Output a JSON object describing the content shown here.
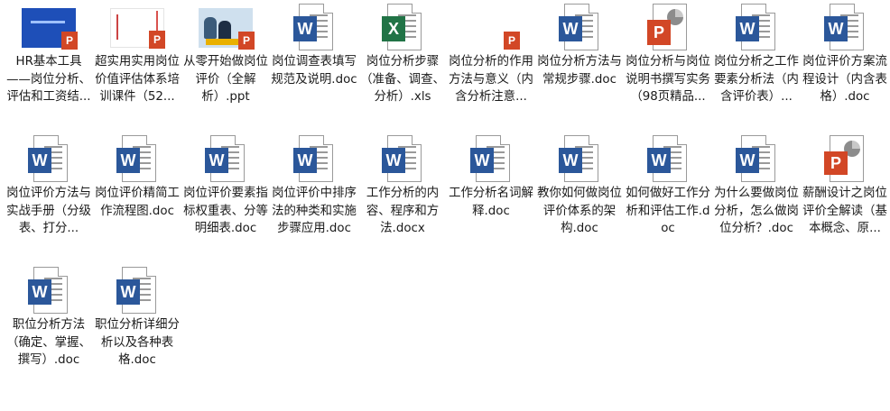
{
  "files": [
    {
      "name": "HR基本工具——岗位分析、评估和工资结...",
      "icon": "ppt-thumbnail-blue"
    },
    {
      "name": "超实用实用岗位价值评估体系培训课件（52...",
      "icon": "ppt-thumbnail-white"
    },
    {
      "name": "从零开始做岗位评价（全解析）.ppt",
      "icon": "ppt-thumbnail-photo"
    },
    {
      "name": "岗位调查表填写规范及说明.doc",
      "icon": "word-doc-icon"
    },
    {
      "name": "岗位分析步骤（准备、调查、分析）.xls",
      "icon": "excel-xls-icon"
    },
    {
      "name": "岗位分析的作用方法与意义（内含分析注意...",
      "icon": "ppt-thumbnail-plain"
    },
    {
      "name": "岗位分析方法与常规步骤.doc",
      "icon": "word-doc-icon"
    },
    {
      "name": "岗位分析与岗位说明书撰写实务（98页精品...",
      "icon": "powerpoint-icon"
    },
    {
      "name": "岗位分析之工作要素分析法（内含评价表）...",
      "icon": "word-doc-icon"
    },
    {
      "name": "岗位评价方案流程设计（内含表格）.doc",
      "icon": "word-doc-icon"
    },
    {
      "name": "岗位评价方法与实战手册（分级表、打分...",
      "icon": "word-doc-icon"
    },
    {
      "name": "岗位评价精简工作流程图.doc",
      "icon": "word-doc-icon"
    },
    {
      "name": "岗位评价要素指标权重表、分等明细表.doc",
      "icon": "word-doc-icon"
    },
    {
      "name": "岗位评价中排序法的种类和实施步骤应用.doc",
      "icon": "word-doc-icon"
    },
    {
      "name": "工作分析的内容、程序和方法.docx",
      "icon": "word-docx-icon"
    },
    {
      "name": "工作分析名词解释.doc",
      "icon": "word-doc-icon"
    },
    {
      "name": "教你如何做岗位评价体系的架构.doc",
      "icon": "word-doc-icon"
    },
    {
      "name": "如何做好工作分析和评估工作.doc",
      "icon": "word-doc-icon"
    },
    {
      "name": "为什么要做岗位分析，怎么做岗位分析？.doc",
      "icon": "word-doc-icon"
    },
    {
      "name": "薪酬设计之岗位评价全解读（基本概念、原...",
      "icon": "powerpoint-icon-small"
    },
    {
      "name": "职位分析方法（确定、掌握、撰写）.doc",
      "icon": "word-doc-icon"
    },
    {
      "name": "职位分析详细分析以及各种表格.doc",
      "icon": "word-doc-icon"
    }
  ],
  "icon_labels": {
    "word": "W",
    "excel": "X",
    "ppt": "P"
  },
  "colors": {
    "word": "#2b579a",
    "excel": "#217346",
    "ppt": "#d24726"
  }
}
